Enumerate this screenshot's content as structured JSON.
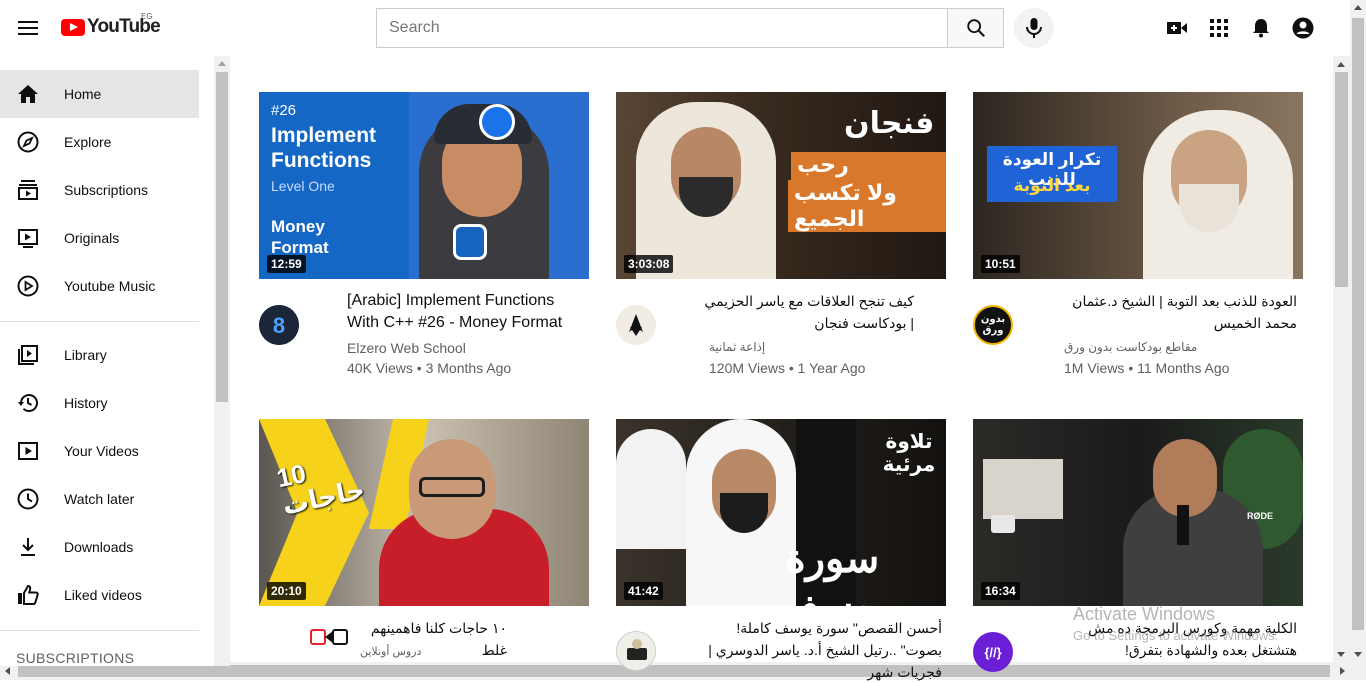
{
  "header": {
    "logo_text": "YouTube",
    "country_code": "EG",
    "search_placeholder": "Search"
  },
  "sidebar": {
    "items": [
      {
        "label": "Home",
        "icon": "home-icon"
      },
      {
        "label": "Explore",
        "icon": "compass-icon"
      },
      {
        "label": "Subscriptions",
        "icon": "subscriptions-icon"
      },
      {
        "label": "Originals",
        "icon": "originals-icon"
      },
      {
        "label": "Youtube Music",
        "icon": "music-icon"
      },
      {
        "label": "Library",
        "icon": "library-icon"
      },
      {
        "label": "History",
        "icon": "history-icon"
      },
      {
        "label": "Your Videos",
        "icon": "your-videos-icon"
      },
      {
        "label": "Watch later",
        "icon": "clock-icon"
      },
      {
        "label": "Downloads",
        "icon": "download-icon"
      },
      {
        "label": "Liked videos",
        "icon": "thumbs-up-icon"
      }
    ],
    "section_title": "SUBSCRIPTIONS"
  },
  "videos": [
    {
      "title": "[Arabic] Implement Functions With C++ #26 - Money Format",
      "channel": "Elzero Web School",
      "meta": "40K Views • 3 Months Ago",
      "duration": "12:59",
      "thumb_text": "#26",
      "thumb_title": "Implement Functions",
      "thumb_sub": "Level One",
      "thumb_foot": "Money Format"
    },
    {
      "title": "كيف تنجح العلاقات مع ياسر الحزيمي | بودكاست فنجان",
      "channel": "إذاعة ثمانية",
      "meta": "120M Views • 1 Year Ago",
      "duration": "3:03:08",
      "thumb_text": "فنجان",
      "thumb_title": "رحب بالعداوات",
      "thumb_sub": "ولا تكسب الجميع"
    },
    {
      "title": "العودة للذنب بعد التوبة | الشيخ د.عثمان محمد الخميس",
      "channel": "مقاطع بودكاست بدون ورق",
      "meta": "1M Views • 11 Months Ago",
      "duration": "10:51",
      "thumb_title": "تكرار العودة للذنب",
      "thumb_sub": "بعد التوبة",
      "avatar_text": "بدون ورق"
    },
    {
      "title": "١٠ حاجات كلنا فاهمينهم غلط",
      "channel": "دروس أونلاين",
      "meta": "",
      "duration": "20:10",
      "thumb_title": "10 حاجات"
    },
    {
      "title": "أحسن القصص\" سورة يوسف كاملة! بصوت\" ..رتيل الشيخ أ.د. ياسر الدوسري | فجريات شهر",
      "channel": "",
      "meta": "",
      "duration": "41:42",
      "thumb_title": "تلاوة مرئية",
      "thumb_sub": "سورة يوسف"
    },
    {
      "title": "الكلية مهمة وكورس البرمجة ده مش هتشتغل بعده والشهادة بتفرق!",
      "channel": "",
      "meta": "",
      "duration": "16:34",
      "thumb_text": "RØDE"
    }
  ],
  "watermark": {
    "line1": "Activate Windows",
    "line2": "Go to Settings to activate Windows."
  },
  "colors": {
    "brand_red": "#ff0000",
    "active_bg": "#e5e5e5",
    "meta_text": "#606060"
  }
}
